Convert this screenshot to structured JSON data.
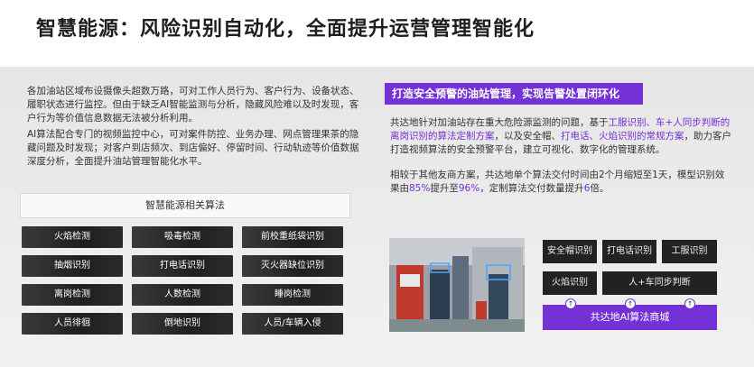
{
  "title": "智慧能源：风险识别自动化，全面提升运营管理智能化",
  "left": {
    "para1": "各加油站区域布设摄像头超数万路，可对工作人员行为、客户行为、设备状态、履职状态进行监控。但由于缺乏AI智能监测与分析，隐藏风险难以及时发现，客户行为等价值信息数据无法被分析利用。",
    "para2": "AI算法配合专门的视频监控中心，可对案件防控、业务办理、网点管理果茶的隐藏问题及时发现；对客户到店频次、到店偏好、停留时间、行动轨迹等价值数据深度分析，全面提升油站管理智能化水平。",
    "algo_header": "智慧能源相关算法",
    "tiles": [
      [
        "火焰检测",
        "吸毒检测",
        "前校重纸袋识别"
      ],
      [
        "抽烟识别",
        "打电话识别",
        "灭火器缺位识别"
      ],
      [
        "离岗检测",
        "人数检测",
        "睡岗检测"
      ],
      [
        "人员徘徊",
        "倒地识别",
        "人员/车辆入侵"
      ]
    ]
  },
  "right": {
    "heading": "打造安全预警的油站管理，实现告警处置闭环化",
    "p1_a": "共达地针对加油站存在重大危险源监测的问题，基于",
    "p1_h1": "工服识别、车+人同步判断的离岗识别的算法定制方案",
    "p1_b": "，以及安全帽、",
    "p1_h2": "打电话、火焰识别的常规方案",
    "p1_c": "，助力客户打造视频算法的安全预警平台，建立可视化、数字化的管理系统。",
    "p2_a": "相较于其他友商方案，共达地单个算法交付时间由2个月缩短至1天，模型识别效果由",
    "p2_h1": "85%",
    "p2_b": "提升至",
    "p2_h2": "96%",
    "p2_c": "，定制算法交付数量提升",
    "p2_h3": "6",
    "p2_d": "倍。",
    "chips_row1": [
      "安全帽识别",
      "打电话识别",
      "工服识别"
    ],
    "chips_row2": [
      "火焰识别",
      "人+车同步判断"
    ],
    "store": "共达地AI算法商城",
    "up_glyph": "↑"
  },
  "colors": {
    "accent": "#7331d6",
    "tile_bg": "#2b2b2b"
  }
}
